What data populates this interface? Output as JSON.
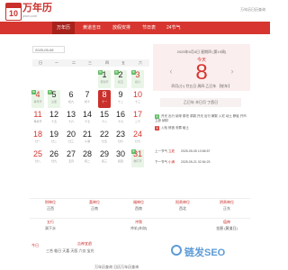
{
  "brand": {
    "logo_num": "10",
    "name": "万年历",
    "sub": "jwwl.com",
    "top_right": "万年历日历查询"
  },
  "nav": [
    {
      "label": "万年历",
      "active": true
    },
    {
      "label": "黄道吉日",
      "active": false
    },
    {
      "label": "放假安排",
      "active": false
    },
    {
      "label": "节日表",
      "active": false
    },
    {
      "label": "24节气",
      "active": false
    }
  ],
  "calendar": {
    "date_input": "2025-05-08",
    "weekdays": [
      "日",
      "一",
      "二",
      "三",
      "四",
      "五",
      "六"
    ],
    "rows": [
      [
        {
          "n": "",
          "s": ""
        },
        {
          "n": "",
          "s": ""
        },
        {
          "n": "",
          "s": ""
        },
        {
          "n": "",
          "s": ""
        },
        {
          "n": "1",
          "s": "劳动节",
          "tag": "休",
          "tc": "green",
          "hl": true
        },
        {
          "n": "2",
          "s": "初五",
          "tag": "休",
          "tc": "green",
          "hl": true
        },
        {
          "n": "3",
          "s": "初六",
          "tag": "休",
          "tc": "green",
          "hl": true
        }
      ],
      [
        {
          "n": "4",
          "s": "青年节",
          "tag": "休",
          "tc": "green",
          "hl": true
        },
        {
          "n": "5",
          "s": "立夏",
          "tag": "休",
          "tc": "green",
          "hl": true
        },
        {
          "n": "6",
          "s": "初九"
        },
        {
          "n": "7",
          "s": "初十"
        },
        {
          "n": "8",
          "s": "十一",
          "today": true
        },
        {
          "n": "9",
          "s": "十二"
        },
        {
          "n": "10",
          "s": "十三"
        }
      ],
      [
        {
          "n": "11",
          "s": "母亲节"
        },
        {
          "n": "12",
          "s": "十五"
        },
        {
          "n": "13",
          "s": "十六"
        },
        {
          "n": "14",
          "s": "十七"
        },
        {
          "n": "15",
          "s": "十八"
        },
        {
          "n": "16",
          "s": "十九"
        },
        {
          "n": "17",
          "s": "二十"
        }
      ],
      [
        {
          "n": "18",
          "s": "廿一"
        },
        {
          "n": "19",
          "s": "廿二"
        },
        {
          "n": "20",
          "s": "廿三"
        },
        {
          "n": "21",
          "s": "小满"
        },
        {
          "n": "22",
          "s": "廿五"
        },
        {
          "n": "23",
          "s": "廿六"
        },
        {
          "n": "24",
          "s": "廿七"
        }
      ],
      [
        {
          "n": "25",
          "s": "廿八"
        },
        {
          "n": "26",
          "s": "廿九"
        },
        {
          "n": "27",
          "s": "五月"
        },
        {
          "n": "28",
          "s": "初二"
        },
        {
          "n": "29",
          "s": "初三"
        },
        {
          "n": "30",
          "s": "初四"
        },
        {
          "n": "31",
          "s": "端午节",
          "tag": "休",
          "tc": "green",
          "hl": true
        }
      ]
    ]
  },
  "detail": {
    "date_line": "2025年5月8日 星期四 (第19周)",
    "weekday": "今天",
    "big_day": "8",
    "ganzhi": "四月(小) 廿五日 周四 乙巳年 【蛇年】",
    "box": "乙巳年 辛巳月 丁酉日",
    "yi_badge": "宜",
    "yi_text": "开光 出行 纳采 祭祀 求嗣 开光 出行 嫁娶 入宅 动土 移徙 开市 立券 纳财",
    "ji_badge": "忌",
    "ji_text": "入殓 修造 安葬 破土",
    "prev_jieqi_label": "上一节气",
    "prev_jieqi_name": "立夏",
    "prev_jieqi_time": "2025-05-05 13:56:57",
    "next_jieqi_label": "下一节气",
    "next_jieqi_name": "小满",
    "next_jieqi_time": "2025-05-21 02:54:23"
  },
  "info_grid": [
    {
      "k": "财神位",
      "v": "正西"
    },
    {
      "k": "喜神位",
      "v": "正南"
    },
    {
      "k": "福神位",
      "v": "西南"
    },
    {
      "k": "阳贵神位",
      "v": "西北"
    },
    {
      "k": "阴贵神位",
      "v": "正东"
    },
    {
      "k": "五行",
      "v": "涧下水"
    },
    {
      "k": "冲煞",
      "v": "冲羊(辛卯)"
    },
    {
      "k": "",
      "v": ""
    },
    {
      "k": "值神",
      "v": "金匮 (黄道日)"
    },
    {
      "k": "",
      "v": ""
    }
  ],
  "bottom": {
    "k1": "吉神宜趋",
    "v1": "三合 临日 天喜 天医 六仪 宝光",
    "k2": "今日",
    "footer": "万年历查询 日历万年历查询"
  },
  "watermark": "链发SEO"
}
